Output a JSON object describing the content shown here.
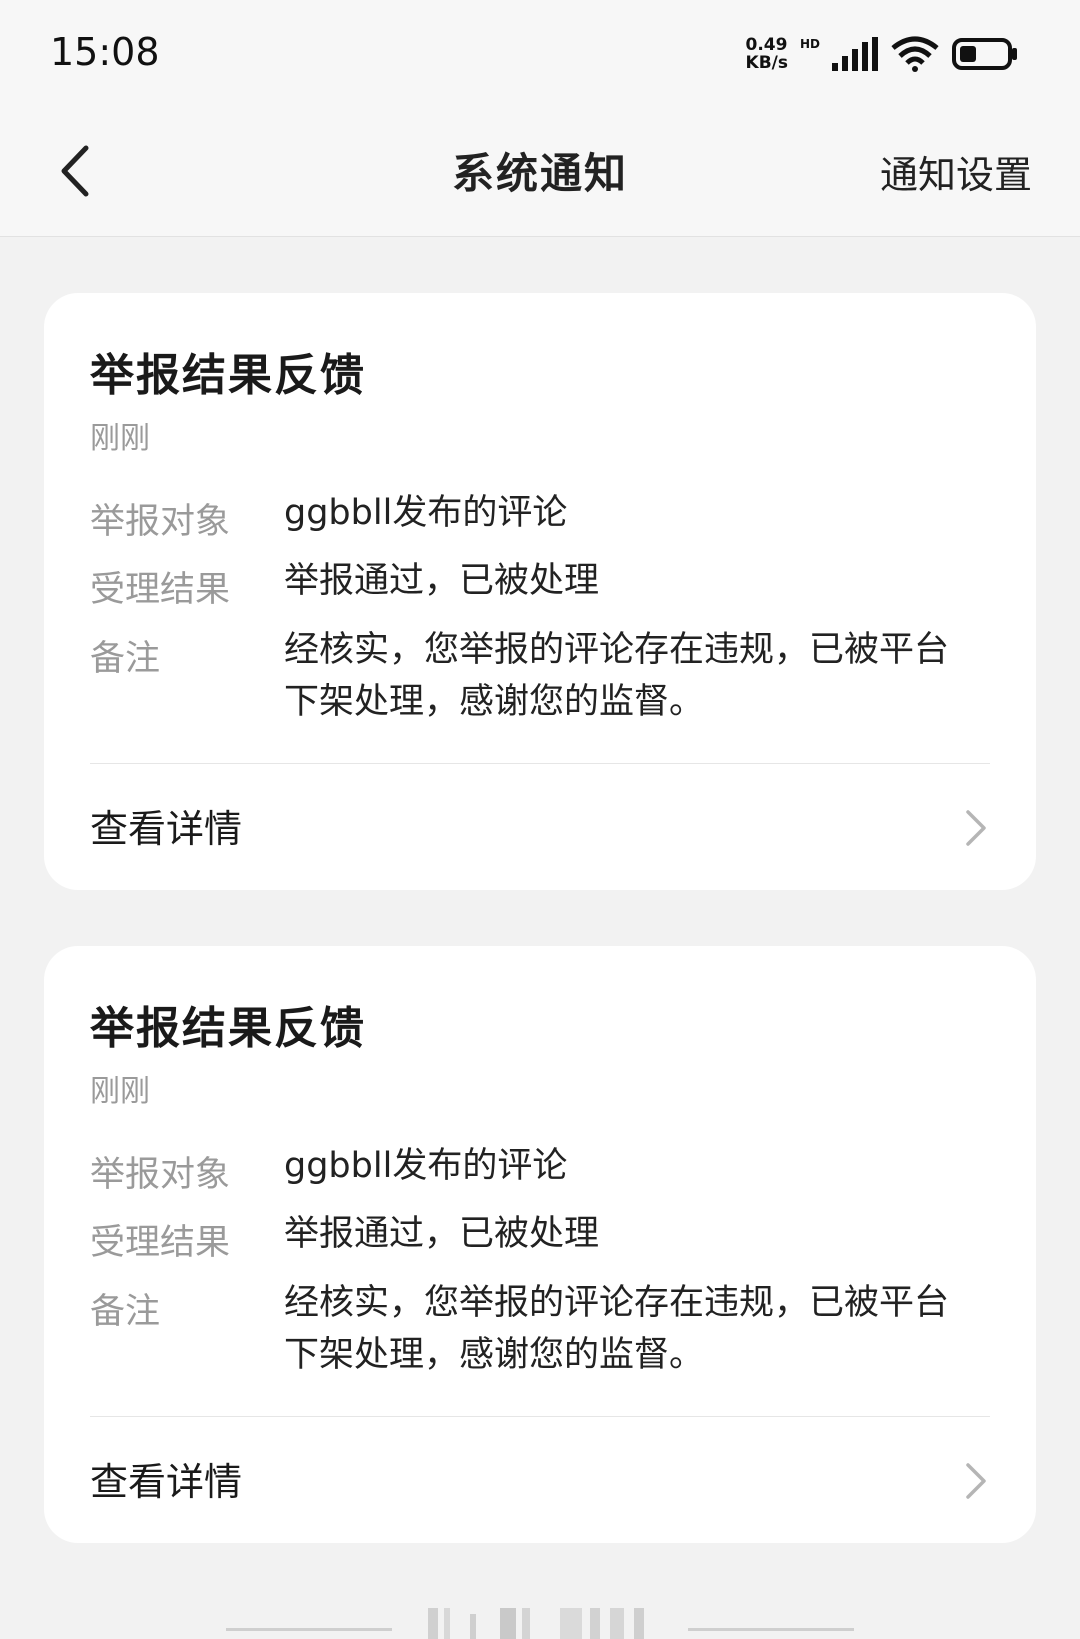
{
  "status_bar": {
    "time": "15:08",
    "net_speed_value": "0.49",
    "net_speed_unit": "KB/s",
    "hd": "HD",
    "icons": [
      "signal-icon",
      "wifi-icon",
      "battery-icon"
    ]
  },
  "header": {
    "title": "系统通知",
    "settings_label": "通知设置",
    "back_icon": "chevron-left-icon"
  },
  "notifications": [
    {
      "title": "举报结果反馈",
      "time": "刚刚",
      "rows": [
        {
          "label": "举报对象",
          "value": "ggbbll发布的评论"
        },
        {
          "label": "受理结果",
          "value": "举报通过，已被处理"
        },
        {
          "label": "备注",
          "value": "经核实，您举报的评论存在违规，已被平台下架处理，感谢您的监督。"
        }
      ],
      "details_label": "查看详情"
    },
    {
      "title": "举报结果反馈",
      "time": "刚刚",
      "rows": [
        {
          "label": "举报对象",
          "value": "ggbbll发布的评论"
        },
        {
          "label": "受理结果",
          "value": "举报通过，已被处理"
        },
        {
          "label": "备注",
          "value": "经核实，您举报的评论存在违规，已被平台下架处理，感谢您的监督。"
        }
      ],
      "details_label": "查看详情"
    }
  ],
  "colors": {
    "background": "#f2f2f2",
    "card": "#ffffff",
    "label_gray": "#9a9a9a",
    "text": "#222222"
  }
}
